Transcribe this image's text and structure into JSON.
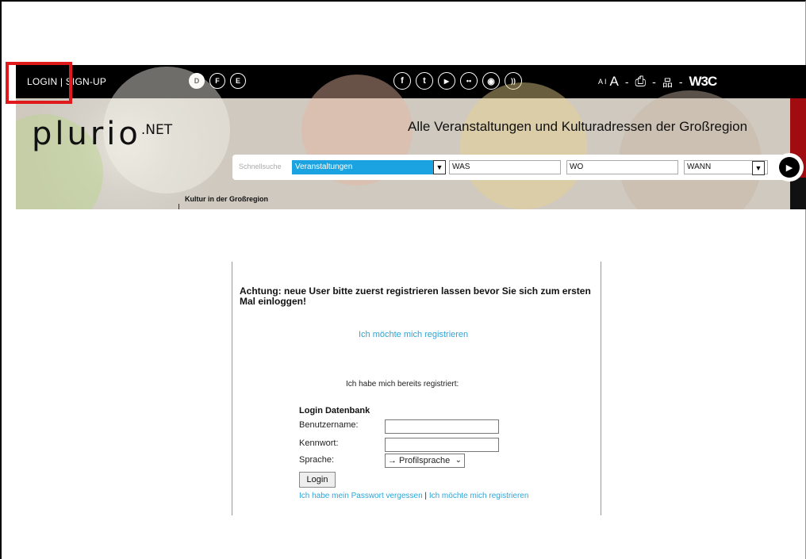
{
  "header": {
    "login_label": "LOGIN | SIGN-UP",
    "languages": [
      "D",
      "F",
      "E"
    ],
    "active_language": "D",
    "socials": [
      {
        "icon": "facebook-icon",
        "glyph": "f"
      },
      {
        "icon": "tumblr-icon",
        "glyph": "t"
      },
      {
        "icon": "youtube-icon",
        "glyph": "▶"
      },
      {
        "icon": "flickr-icon",
        "glyph": "••"
      },
      {
        "icon": "podcast-icon",
        "glyph": "◉"
      },
      {
        "icon": "rss-icon",
        "glyph": "))"
      }
    ],
    "font_small": "A",
    "font_sep": "I",
    "font_large": "A",
    "dash": "-",
    "print_icon": "⎙",
    "sitemap_icon": "品",
    "w3c_label": "W3C"
  },
  "banner": {
    "logo_main": "plurio",
    "logo_suffix": ".NET",
    "tagline": "Alle Veranstaltungen und Kulturadressen der Großregion",
    "quick_search_label": "Schnellsuche",
    "category_value": "Veranstaltungen",
    "was_value": "WAS",
    "wo_value": "WO",
    "wann_value": "WANN",
    "go_glyph": "▶",
    "nav_label": "Kultur in der Großregion"
  },
  "login": {
    "warning": "Achtung: neue User bitte zuerst registrieren lassen bevor Sie sich zum ersten Mal einloggen!",
    "register_link": "Ich möchte mich registrieren",
    "already_registered": "Ich habe mich bereits registriert:",
    "form_title": "Login Datenbank",
    "username_label": "Benutzername:",
    "password_label": "Kennwort:",
    "language_label": "Sprache:",
    "language_value": "→ Profilsprache",
    "submit_label": "Login",
    "forgot_link": "Ich habe mein Passwort vergessen",
    "separator": "|",
    "register_link_2": "Ich möchte mich registrieren"
  },
  "colors": {
    "accent_blue": "#1aa3e0",
    "link_blue": "#2aa6d8",
    "highlight_red": "#e0191c",
    "banner_red": "#a00c10"
  }
}
